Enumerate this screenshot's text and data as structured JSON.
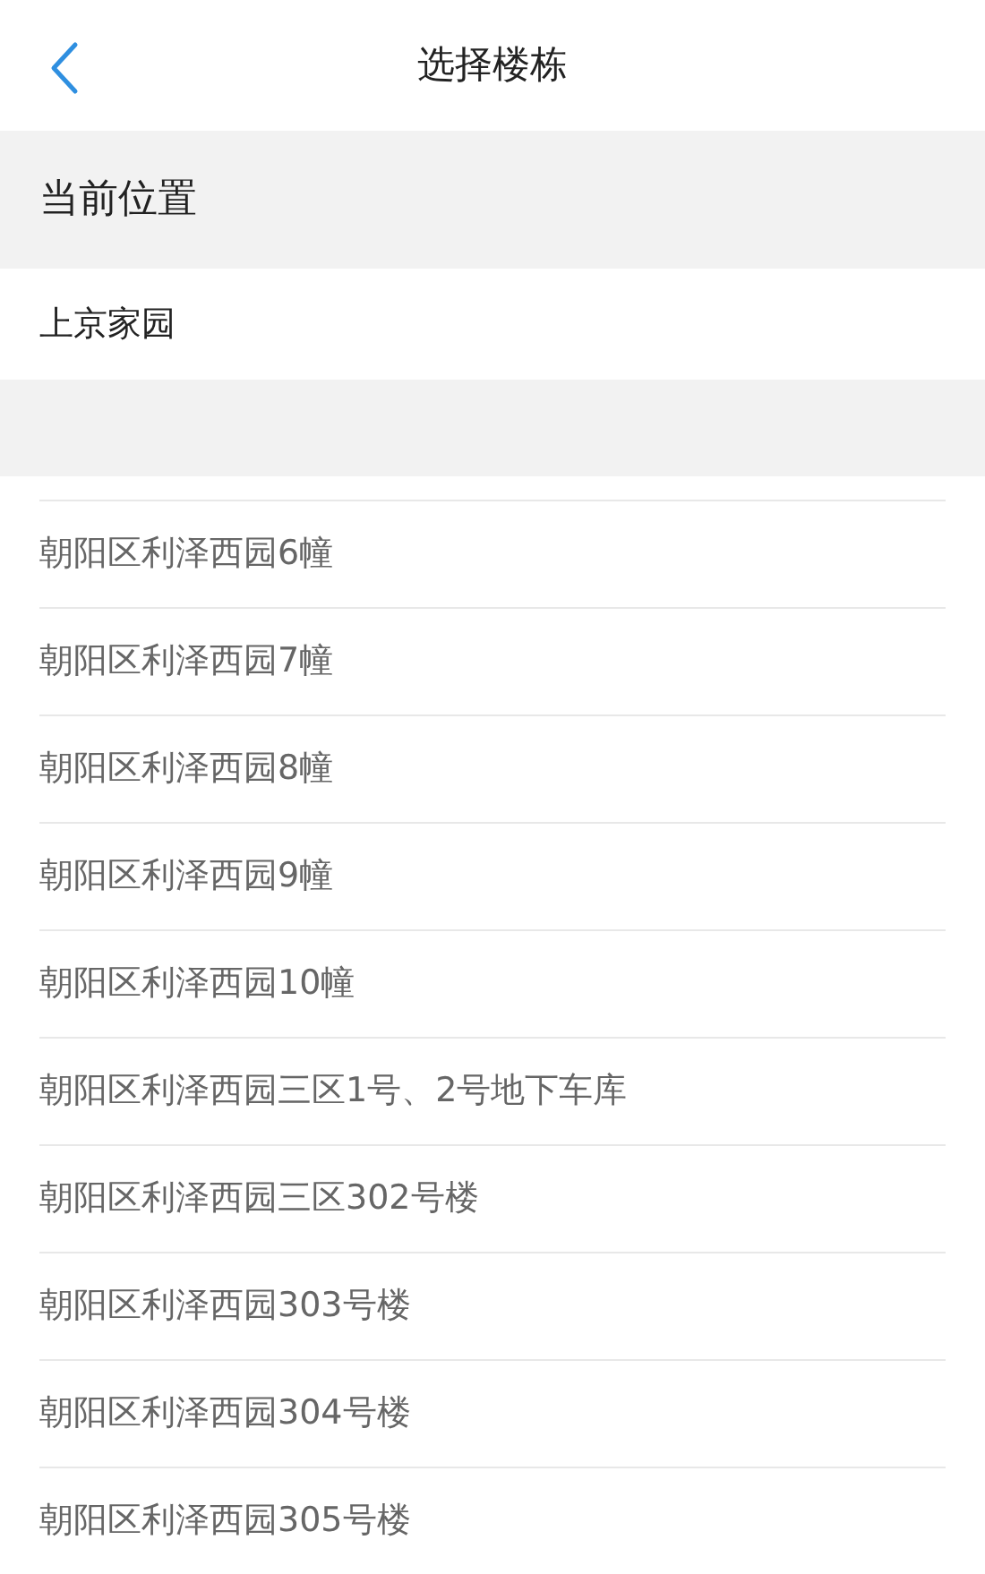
{
  "header": {
    "title": "选择楼栋"
  },
  "current_location": {
    "heading": "当前位置",
    "value": "上京家园"
  },
  "buildings": [
    {
      "name": "朝阳区利泽西园6幢"
    },
    {
      "name": "朝阳区利泽西园7幢"
    },
    {
      "name": "朝阳区利泽西园8幢"
    },
    {
      "name": "朝阳区利泽西园9幢"
    },
    {
      "name": "朝阳区利泽西园10幢"
    },
    {
      "name": "朝阳区利泽西园三区1号、2号地下车库"
    },
    {
      "name": "朝阳区利泽西园三区302号楼"
    },
    {
      "name": "朝阳区利泽西园303号楼"
    },
    {
      "name": "朝阳区利泽西园304号楼"
    },
    {
      "name": "朝阳区利泽西园305号楼"
    }
  ]
}
